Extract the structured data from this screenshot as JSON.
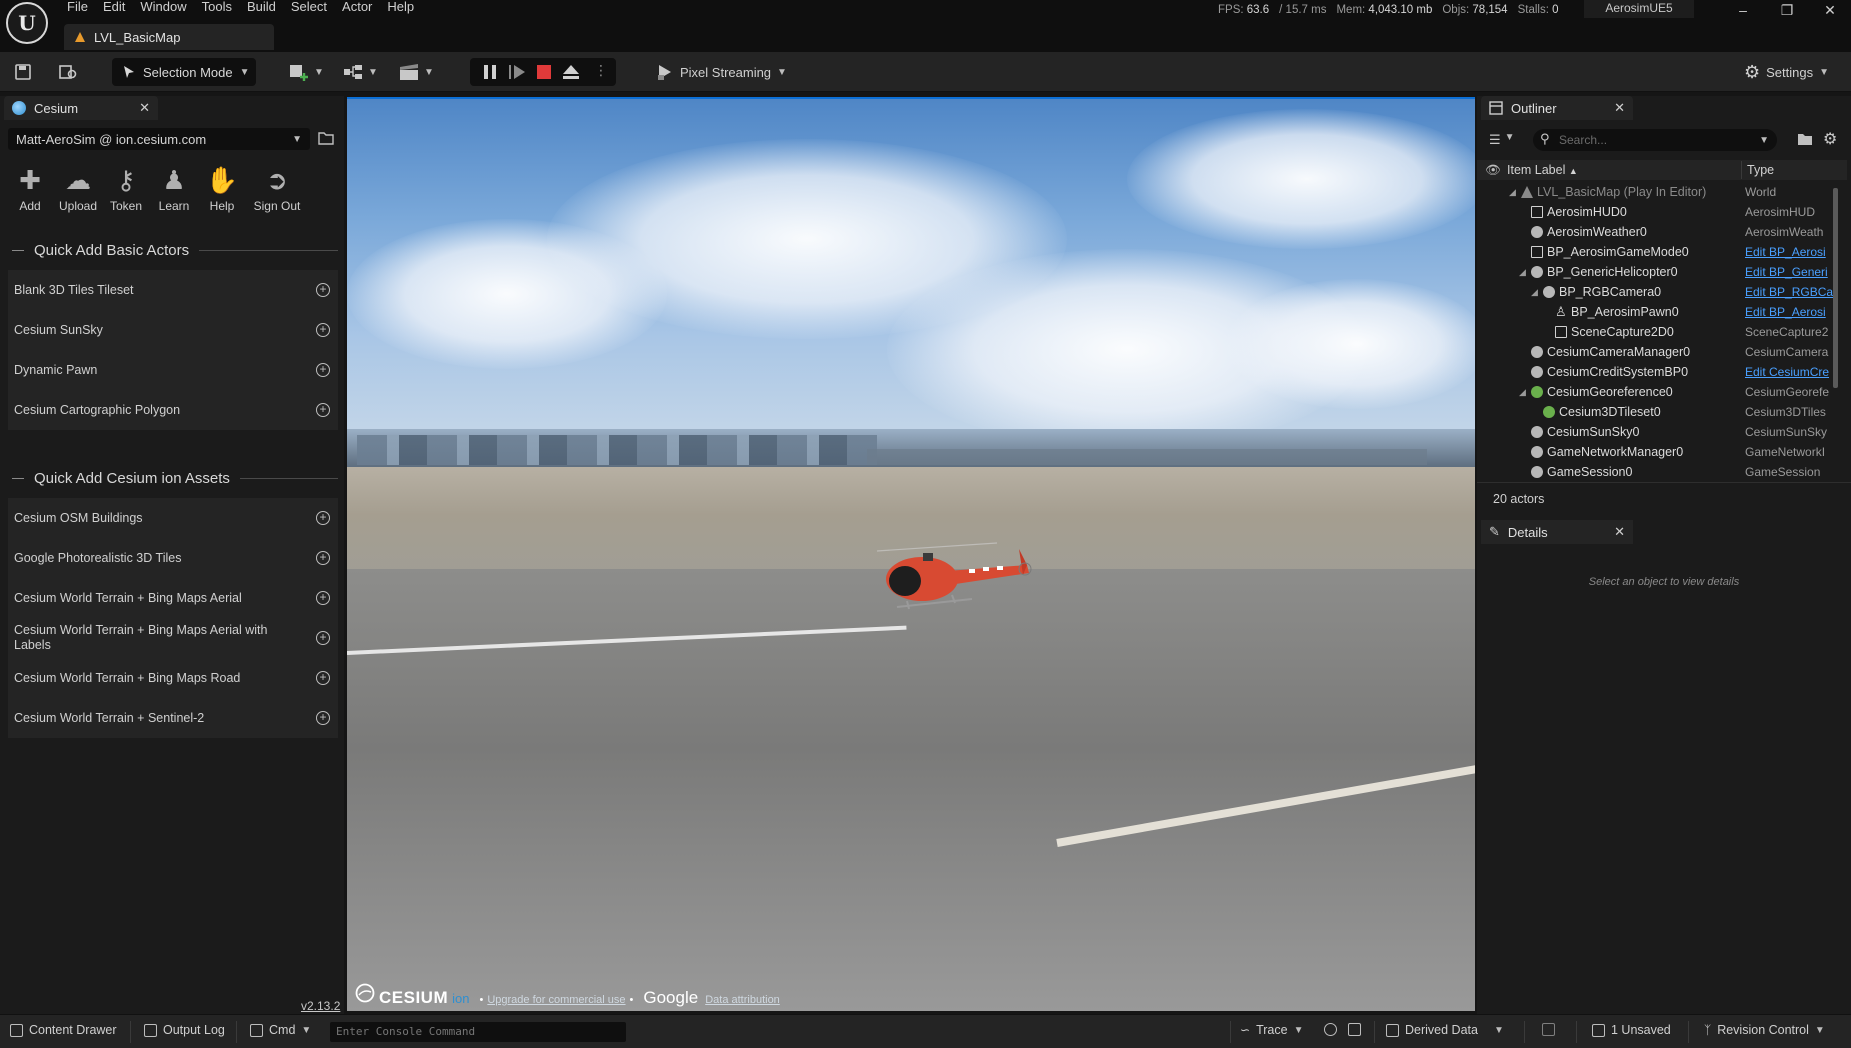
{
  "menu": [
    "File",
    "Edit",
    "Window",
    "Tools",
    "Build",
    "Select",
    "Actor",
    "Help"
  ],
  "document_tab": "LVL_BasicMap",
  "stats": {
    "fps_label": "FPS:",
    "fps": "63.6",
    "ms": "/ 15.7 ms",
    "mem_label": "Mem:",
    "mem": "4,043.10 mb",
    "objs_label": "Objs:",
    "objs": "78,154",
    "stalls_label": "Stalls:",
    "stalls": "0"
  },
  "project_name": "AerosimUE5",
  "toolbar": {
    "mode": "Selection Mode",
    "pixel_streaming": "Pixel Streaming",
    "settings": "Settings"
  },
  "cesium_panel": {
    "tab": "Cesium",
    "account": "Matt-AeroSim @ ion.cesium.com",
    "buttons": [
      "Add",
      "Upload",
      "Token",
      "Learn",
      "Help",
      "Sign Out"
    ],
    "basic_title": "Quick Add Basic Actors",
    "basic_actors": [
      "Blank 3D Tiles Tileset",
      "Cesium SunSky",
      "Dynamic Pawn",
      "Cesium Cartographic Polygon"
    ],
    "ion_title": "Quick Add Cesium ion Assets",
    "ion_assets": [
      "Cesium OSM Buildings",
      "Google Photorealistic 3D Tiles",
      "Cesium World Terrain + Bing Maps Aerial",
      "Cesium World Terrain + Bing Maps Aerial with Labels",
      "Cesium World Terrain + Bing Maps Road",
      "Cesium World Terrain + Sentinel-2"
    ],
    "version": "v2.13.2"
  },
  "viewport": {
    "cesium_logo": "CESIUM",
    "cesium_ion": "ion",
    "upgrade": "Upgrade for commercial use",
    "dot": "•",
    "google": "Google",
    "attribution": "Data attribution"
  },
  "outliner": {
    "tab": "Outliner",
    "search_placeholder": "Search...",
    "col_label": "Item Label",
    "col_type": "Type",
    "rows": [
      {
        "label": "LVL_BasicMap (Play In Editor)",
        "type": "World"
      },
      {
        "label": "AerosimHUD0",
        "type": "AerosimHUD"
      },
      {
        "label": "AerosimWeather0",
        "type": "AerosimWeath"
      },
      {
        "label": "BP_AerosimGameMode0",
        "type": "Edit BP_Aerosi"
      },
      {
        "label": "BP_GenericHelicopter0",
        "type": "Edit BP_Generi"
      },
      {
        "label": "BP_RGBCamera0",
        "type": "Edit BP_RGBCa"
      },
      {
        "label": "BP_AerosimPawn0",
        "type": "Edit BP_Aerosi"
      },
      {
        "label": "SceneCapture2D0",
        "type": "SceneCapture2"
      },
      {
        "label": "CesiumCameraManager0",
        "type": "CesiumCamera"
      },
      {
        "label": "CesiumCreditSystemBP0",
        "type": "Edit CesiumCre"
      },
      {
        "label": "CesiumGeoreference0",
        "type": "CesiumGeorefe"
      },
      {
        "label": "Cesium3DTileset0",
        "type": "Cesium3DTiles"
      },
      {
        "label": "CesiumSunSky0",
        "type": "CesiumSunSky"
      },
      {
        "label": "GameNetworkManager0",
        "type": "GameNetworkI"
      },
      {
        "label": "GameSession0",
        "type": "GameSession"
      }
    ],
    "count": "20 actors"
  },
  "details": {
    "tab": "Details",
    "empty": "Select an object to view details"
  },
  "statusbar": {
    "content_drawer": "Content Drawer",
    "output_log": "Output Log",
    "cmd": "Cmd",
    "console_placeholder": "Enter Console Command",
    "trace": "Trace",
    "derived_data": "Derived Data",
    "unsaved": "1 Unsaved",
    "revision_control": "Revision Control"
  }
}
